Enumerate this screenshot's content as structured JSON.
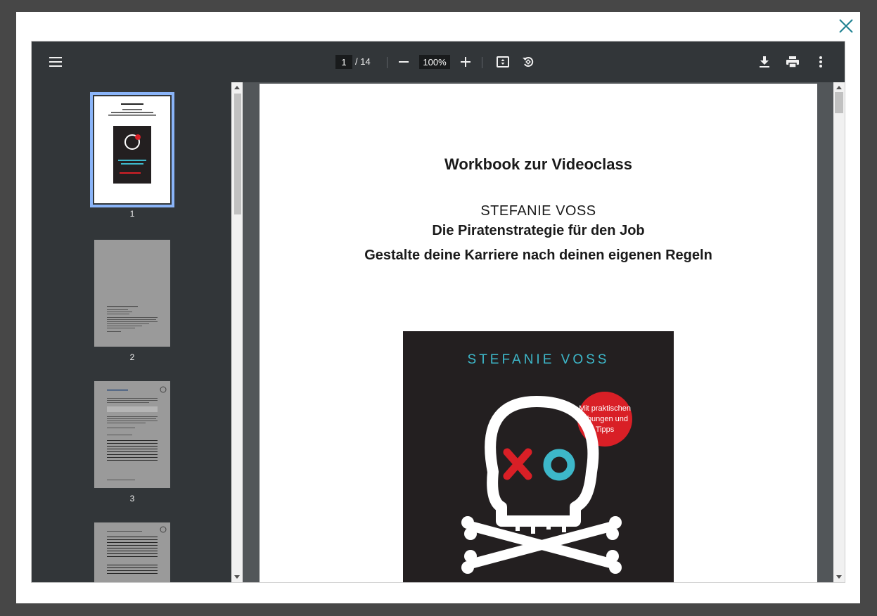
{
  "toolbar": {
    "current_page": "1",
    "page_total": "/ 14",
    "zoom": "100%",
    "icons": [
      "menu-icon",
      "zoom-out-icon",
      "zoom-in-icon",
      "fit-page-icon",
      "rotate-icon",
      "download-icon",
      "print-icon",
      "more-icon"
    ]
  },
  "thumbnails": [
    {
      "label": "1"
    },
    {
      "label": "2"
    },
    {
      "label": "3"
    }
  ],
  "document": {
    "title": "Workbook zur Videoclass",
    "author": "STEFANIE VOSS",
    "subtitle1": "Die Piratenstrategie für den Job",
    "subtitle2": "Gestalte deine Karriere nach deinen eigenen Regeln",
    "cover": {
      "author": "STEFANIE VOSS",
      "badge": "Mit praktischen Übungen und Tipps"
    }
  },
  "colors": {
    "accent": "#3db7c9",
    "badge": "#d91f26",
    "close": "#1a7f8f"
  }
}
